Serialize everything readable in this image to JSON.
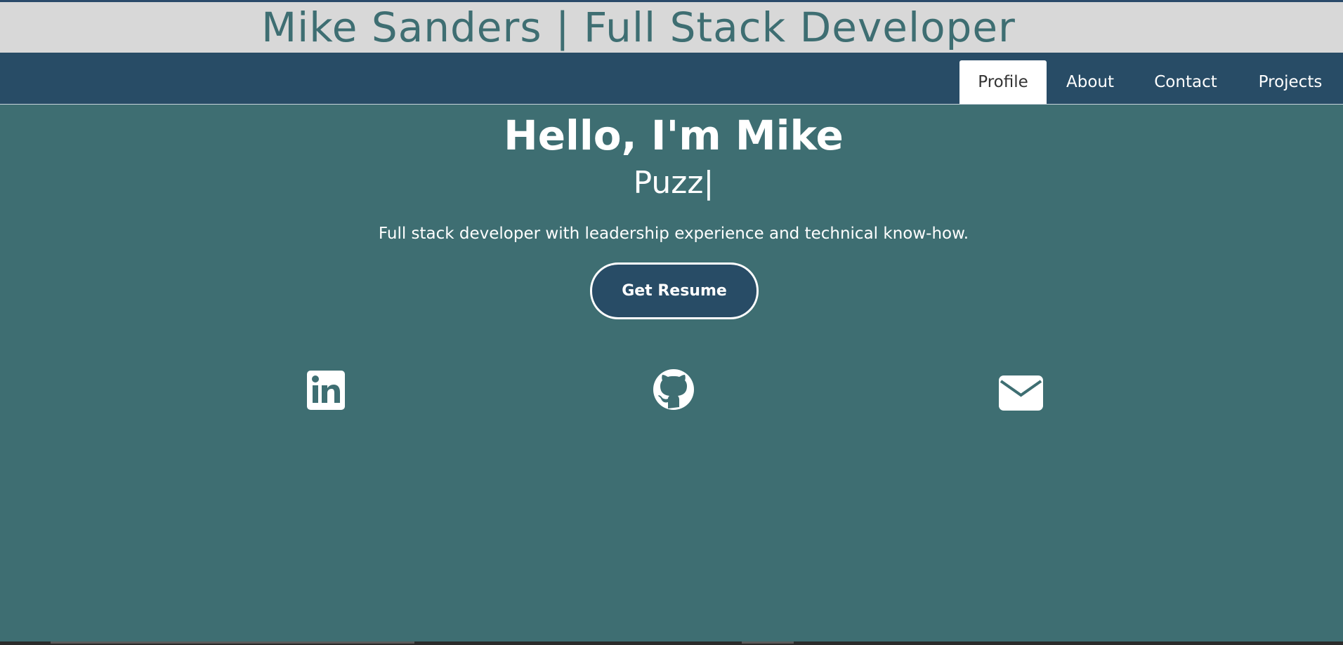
{
  "header": {
    "title": "Mike Sanders | Full Stack Developer"
  },
  "nav": {
    "tabs": [
      {
        "label": "Profile",
        "active": true
      },
      {
        "label": "About",
        "active": false
      },
      {
        "label": "Contact",
        "active": false
      },
      {
        "label": "Projects",
        "active": false
      }
    ]
  },
  "hero": {
    "greeting": "Hello, I'm Mike",
    "typed_text": "Puzz|",
    "tagline": "Full stack developer with leadership experience and technical know-how.",
    "resume_button": "Get Resume"
  },
  "social": [
    {
      "icon": "linkedin-icon"
    },
    {
      "icon": "github-icon"
    },
    {
      "icon": "email-icon"
    }
  ],
  "colors": {
    "page_background": "#3e6e72",
    "header_background": "#d8d8d8",
    "nav_background": "#284c66",
    "title_color": "#3e6e72",
    "text_color": "#ffffff"
  }
}
